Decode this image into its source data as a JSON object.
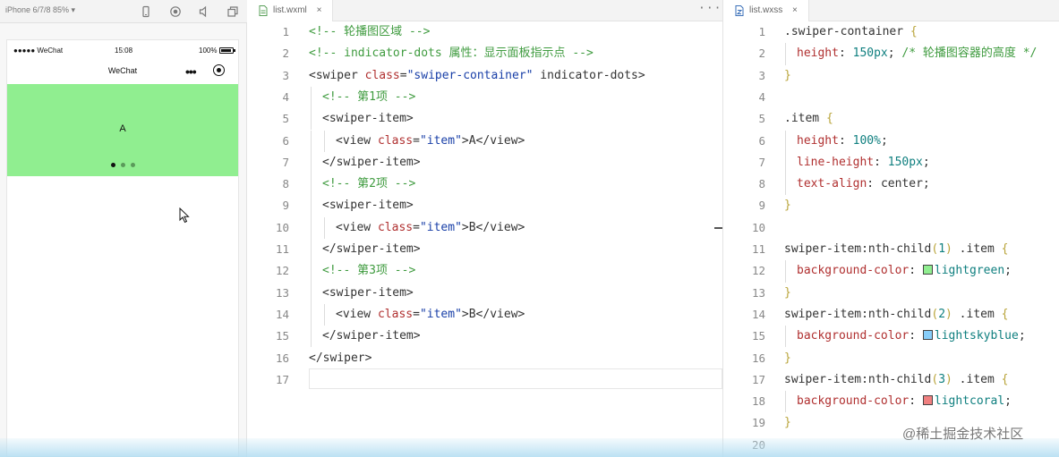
{
  "simulator": {
    "device": "iPhone 6/7/8 85% ▾",
    "status": {
      "signal": "●●●●● WeChat",
      "time": "15:08",
      "battery": "100%"
    },
    "nav_title": "WeChat",
    "nav_more": "•••",
    "swiper": {
      "text": "A",
      "color": "#90ee90",
      "dots": 3,
      "active_dot": 0
    }
  },
  "wxml_editor": {
    "tab_label": "list.wxml",
    "tab_close": "×",
    "more": "···",
    "lines": [
      {
        "n": "1",
        "indent": 0,
        "parts": [
          {
            "t": "<!-- 轮播图区域 -->",
            "c": "com"
          }
        ]
      },
      {
        "n": "2",
        "indent": 0,
        "parts": [
          {
            "t": "<!-- indicator-dots 属性：显示面板指示点 -->",
            "c": "com"
          }
        ]
      },
      {
        "n": "3",
        "indent": 0,
        "parts": [
          {
            "t": "<swiper ",
            "c": "tag"
          },
          {
            "t": "class",
            "c": "attr"
          },
          {
            "t": "=",
            "c": "tag"
          },
          {
            "t": "\"swiper-container\"",
            "c": "str"
          },
          {
            "t": " indicator-dots>",
            "c": "tag"
          }
        ]
      },
      {
        "n": "4",
        "indent": 1,
        "parts": [
          {
            "t": "<!-- 第1项 -->",
            "c": "com"
          }
        ]
      },
      {
        "n": "5",
        "indent": 1,
        "parts": [
          {
            "t": "<swiper-item>",
            "c": "tag"
          }
        ]
      },
      {
        "n": "6",
        "indent": 2,
        "parts": [
          {
            "t": "<view ",
            "c": "tag"
          },
          {
            "t": "class",
            "c": "attr"
          },
          {
            "t": "=",
            "c": "tag"
          },
          {
            "t": "\"item\"",
            "c": "str"
          },
          {
            "t": ">A</view>",
            "c": "tag"
          }
        ]
      },
      {
        "n": "7",
        "indent": 1,
        "parts": [
          {
            "t": "</swiper-item>",
            "c": "tag"
          }
        ]
      },
      {
        "n": "8",
        "indent": 1,
        "parts": [
          {
            "t": "<!-- 第2项 -->",
            "c": "com"
          }
        ]
      },
      {
        "n": "9",
        "indent": 1,
        "parts": [
          {
            "t": "<swiper-item>",
            "c": "tag"
          }
        ]
      },
      {
        "n": "10",
        "indent": 2,
        "parts": [
          {
            "t": "<view ",
            "c": "tag"
          },
          {
            "t": "class",
            "c": "attr"
          },
          {
            "t": "=",
            "c": "tag"
          },
          {
            "t": "\"item\"",
            "c": "str"
          },
          {
            "t": ">B</view>",
            "c": "tag"
          }
        ]
      },
      {
        "n": "11",
        "indent": 1,
        "parts": [
          {
            "t": "</swiper-item>",
            "c": "tag"
          }
        ]
      },
      {
        "n": "12",
        "indent": 1,
        "parts": [
          {
            "t": "<!-- 第3项 -->",
            "c": "com"
          }
        ]
      },
      {
        "n": "13",
        "indent": 1,
        "parts": [
          {
            "t": "<swiper-item>",
            "c": "tag"
          }
        ]
      },
      {
        "n": "14",
        "indent": 2,
        "parts": [
          {
            "t": "<view ",
            "c": "tag"
          },
          {
            "t": "class",
            "c": "attr"
          },
          {
            "t": "=",
            "c": "tag"
          },
          {
            "t": "\"item\"",
            "c": "str"
          },
          {
            "t": ">B</view>",
            "c": "tag"
          }
        ]
      },
      {
        "n": "15",
        "indent": 1,
        "parts": [
          {
            "t": "</swiper-item>",
            "c": "tag"
          }
        ]
      },
      {
        "n": "16",
        "indent": 0,
        "parts": [
          {
            "t": "</swiper>",
            "c": "tag"
          }
        ]
      },
      {
        "n": "17",
        "indent": 0,
        "parts": []
      }
    ]
  },
  "wxss_editor": {
    "tab_label": "list.wxss",
    "tab_close": "×",
    "lines": [
      {
        "n": "1",
        "indent": 0,
        "parts": [
          {
            "t": ".swiper-container ",
            "c": "sel"
          },
          {
            "t": "{",
            "c": "brace"
          }
        ]
      },
      {
        "n": "2",
        "indent": 1,
        "parts": [
          {
            "t": "height",
            "c": "prop"
          },
          {
            "t": ": ",
            "c": "sel"
          },
          {
            "t": "150px",
            "c": "num"
          },
          {
            "t": "; ",
            "c": "sel"
          },
          {
            "t": "/* 轮播图容器的高度 */",
            "c": "com"
          }
        ]
      },
      {
        "n": "3",
        "indent": 0,
        "parts": [
          {
            "t": "}",
            "c": "brace"
          }
        ]
      },
      {
        "n": "4",
        "indent": 0,
        "parts": []
      },
      {
        "n": "5",
        "indent": 0,
        "parts": [
          {
            "t": ".item ",
            "c": "sel"
          },
          {
            "t": "{",
            "c": "brace"
          }
        ]
      },
      {
        "n": "6",
        "indent": 1,
        "parts": [
          {
            "t": "height",
            "c": "prop"
          },
          {
            "t": ": ",
            "c": "sel"
          },
          {
            "t": "100%",
            "c": "num"
          },
          {
            "t": ";",
            "c": "sel"
          }
        ]
      },
      {
        "n": "7",
        "indent": 1,
        "parts": [
          {
            "t": "line-height",
            "c": "prop"
          },
          {
            "t": ": ",
            "c": "sel"
          },
          {
            "t": "150px",
            "c": "num"
          },
          {
            "t": ";",
            "c": "sel"
          }
        ]
      },
      {
        "n": "8",
        "indent": 1,
        "parts": [
          {
            "t": "text-align",
            "c": "prop"
          },
          {
            "t": ": ",
            "c": "sel"
          },
          {
            "t": "center",
            "c": "sel"
          },
          {
            "t": ";",
            "c": "sel"
          }
        ]
      },
      {
        "n": "9",
        "indent": 0,
        "parts": [
          {
            "t": "}",
            "c": "brace"
          }
        ]
      },
      {
        "n": "10",
        "indent": 0,
        "parts": []
      },
      {
        "n": "11",
        "indent": 0,
        "parts": [
          {
            "t": "swiper-item:nth-child",
            "c": "sel"
          },
          {
            "t": "(",
            "c": "brace"
          },
          {
            "t": "1",
            "c": "num"
          },
          {
            "t": ")",
            "c": "brace"
          },
          {
            "t": " .item ",
            "c": "sel"
          },
          {
            "t": "{",
            "c": "brace"
          }
        ]
      },
      {
        "n": "12",
        "indent": 1,
        "parts": [
          {
            "t": "background-color",
            "c": "prop"
          },
          {
            "t": ": ",
            "c": "sel"
          },
          {
            "t": "",
            "c": "swatch",
            "color": "#90ee90"
          },
          {
            "t": "lightgreen",
            "c": "kw"
          },
          {
            "t": ";",
            "c": "sel"
          }
        ]
      },
      {
        "n": "13",
        "indent": 0,
        "parts": [
          {
            "t": "}",
            "c": "brace"
          }
        ]
      },
      {
        "n": "14",
        "indent": 0,
        "parts": [
          {
            "t": "swiper-item:nth-child",
            "c": "sel"
          },
          {
            "t": "(",
            "c": "brace"
          },
          {
            "t": "2",
            "c": "num"
          },
          {
            "t": ")",
            "c": "brace"
          },
          {
            "t": " .item ",
            "c": "sel"
          },
          {
            "t": "{",
            "c": "brace"
          }
        ]
      },
      {
        "n": "15",
        "indent": 1,
        "parts": [
          {
            "t": "background-color",
            "c": "prop"
          },
          {
            "t": ": ",
            "c": "sel"
          },
          {
            "t": "",
            "c": "swatch",
            "color": "#87cefa"
          },
          {
            "t": "lightskyblue",
            "c": "kw"
          },
          {
            "t": ";",
            "c": "sel"
          }
        ]
      },
      {
        "n": "16",
        "indent": 0,
        "parts": [
          {
            "t": "}",
            "c": "brace"
          }
        ]
      },
      {
        "n": "17",
        "indent": 0,
        "parts": [
          {
            "t": "swiper-item:nth-child",
            "c": "sel"
          },
          {
            "t": "(",
            "c": "brace"
          },
          {
            "t": "3",
            "c": "num"
          },
          {
            "t": ")",
            "c": "brace"
          },
          {
            "t": " .item ",
            "c": "sel"
          },
          {
            "t": "{",
            "c": "brace"
          }
        ]
      },
      {
        "n": "18",
        "indent": 1,
        "parts": [
          {
            "t": "background-color",
            "c": "prop"
          },
          {
            "t": ": ",
            "c": "sel"
          },
          {
            "t": "",
            "c": "swatch",
            "color": "#f08080"
          },
          {
            "t": "lightcoral",
            "c": "kw"
          },
          {
            "t": ";",
            "c": "sel"
          }
        ]
      },
      {
        "n": "19",
        "indent": 0,
        "parts": [
          {
            "t": "}",
            "c": "brace"
          }
        ]
      },
      {
        "n": "20",
        "indent": 0,
        "parts": []
      }
    ]
  },
  "watermark": "@稀土掘金技术社区"
}
